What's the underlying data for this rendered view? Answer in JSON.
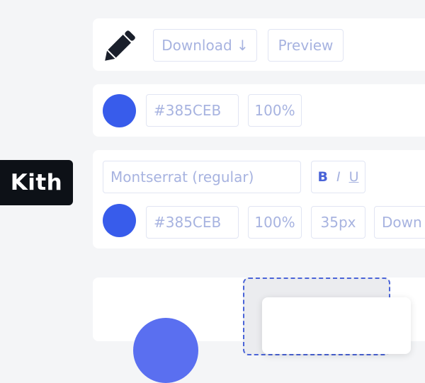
{
  "toolbar": {
    "download_label": "Download ↓",
    "preview_label": "Preview"
  },
  "fill": {
    "color_hex": "#385CEB",
    "opacity": "100%"
  },
  "text_settings": {
    "font_name": "Montserrat (regular)",
    "bold_label": "B",
    "italic_label": "I",
    "underline_label": "U",
    "color_hex": "#385CEB",
    "opacity": "100%",
    "size": "35px",
    "truncated_dropdown": "Down"
  },
  "badge": {
    "text": "Kith"
  },
  "icons": [
    "pencil-icon"
  ],
  "colors": {
    "accent": "#385CEB",
    "badge_bg": "#0D1117",
    "control_text": "#A7B3E0"
  }
}
